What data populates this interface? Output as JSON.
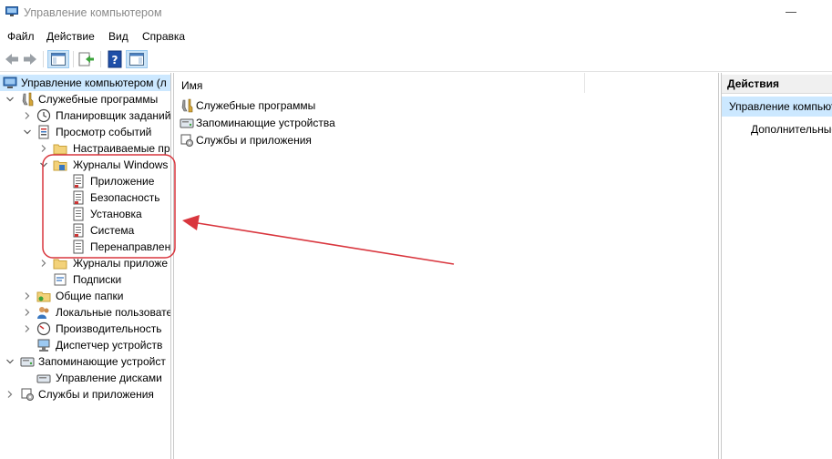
{
  "window": {
    "title": "Управление компьютером"
  },
  "menu": [
    "Файл",
    "Действие",
    "Вид",
    "Справка"
  ],
  "tree": {
    "root": "Управление компьютером (л",
    "system_tools": "Служебные программы",
    "task_scheduler": "Планировщик заданий",
    "event_viewer": "Просмотр событий",
    "custom_views": "Настраиваемые пр",
    "windows_logs": "Журналы Windows",
    "log_application": "Приложение",
    "log_security": "Безопасность",
    "log_setup": "Установка",
    "log_system": "Система",
    "log_forwarded": "Перенаправлен",
    "app_logs": "Журналы приложе",
    "subscriptions": "Подписки",
    "shared_folders": "Общие папки",
    "local_users": "Локальные пользовате",
    "performance": "Производительность",
    "device_manager": "Диспетчер устройств",
    "storage": "Запоминающие устройст",
    "disk_management": "Управление дисками",
    "services_apps": "Службы и приложения"
  },
  "center": {
    "column_header": "Имя",
    "items": [
      "Служебные программы",
      "Запоминающие устройства",
      "Службы и приложения"
    ]
  },
  "actions": {
    "header": "Действия",
    "section": "Управление компьюте",
    "item": "Дополнительные"
  },
  "annotation_color": "#d9363e"
}
